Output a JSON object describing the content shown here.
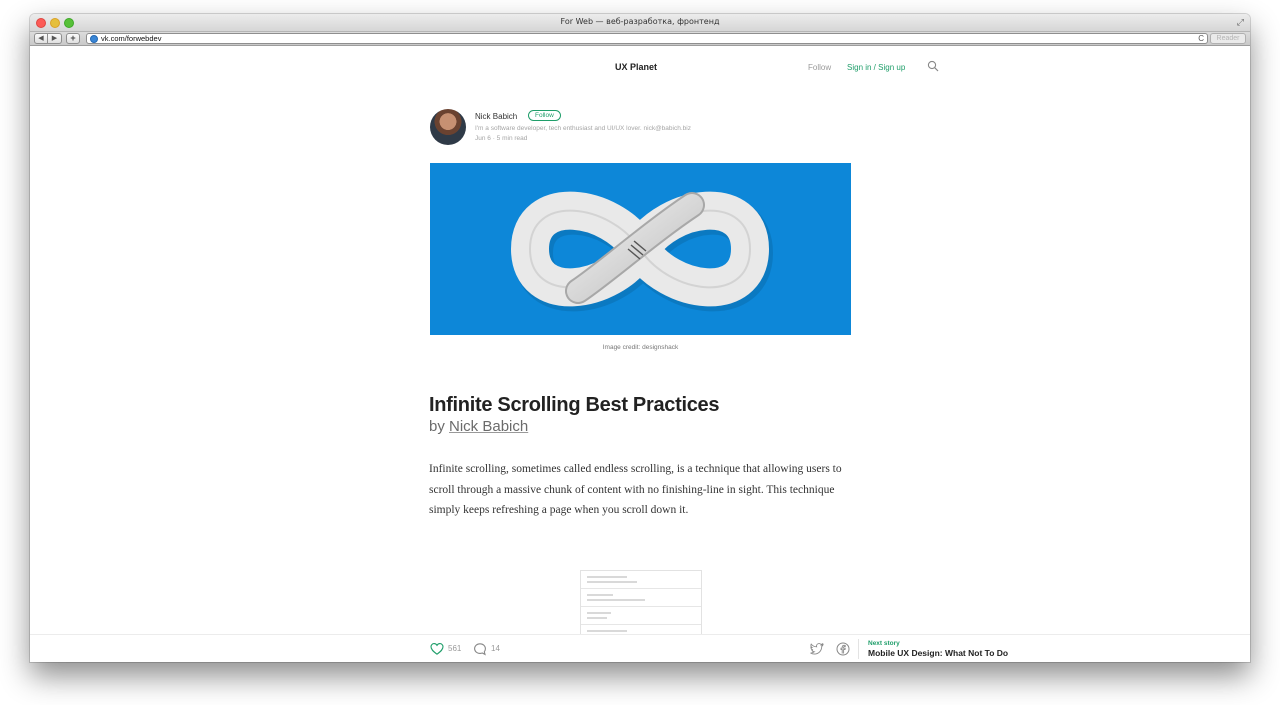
{
  "browser": {
    "window_title": "For Web — веб-разработка, фронтенд",
    "url": "vk.com/forwebdev",
    "reader_label": "Reader",
    "back_glyph": "◀",
    "forward_glyph": "▶",
    "add_glyph": "+",
    "reload_glyph": "C",
    "fullscreen_glyph": "⤢"
  },
  "nav": {
    "publication": "UX Planet",
    "follow": "Follow",
    "signin": "Sign in / Sign up",
    "search_icon": "search-icon"
  },
  "author": {
    "name": "Nick Babich",
    "follow_label": "Follow",
    "bio": "I'm a software developer, tech enthusiast and UI/UX lover. nick@babich.biz",
    "meta": "Jun 6 · 5 min read"
  },
  "hero": {
    "caption": "Image credit: designshack",
    "background_color": "#0d87d8"
  },
  "article": {
    "title": "Infinite Scrolling Best Practices",
    "by_prefix": "by ",
    "by_author": "Nick Babich",
    "body": "Infinite scrolling, sometimes called endless scrolling, is a technique that allowing users to scroll through a massive chunk of content with no finishing-line in sight. This technique simply keeps refreshing a page when you scroll down it."
  },
  "actions": {
    "likes": "561",
    "comments": "14",
    "next_label": "Next story",
    "next_title": "Mobile UX Design: What Not To Do"
  },
  "colors": {
    "accent_green": "#1f9e6a",
    "hero_blue": "#0d87d8"
  }
}
